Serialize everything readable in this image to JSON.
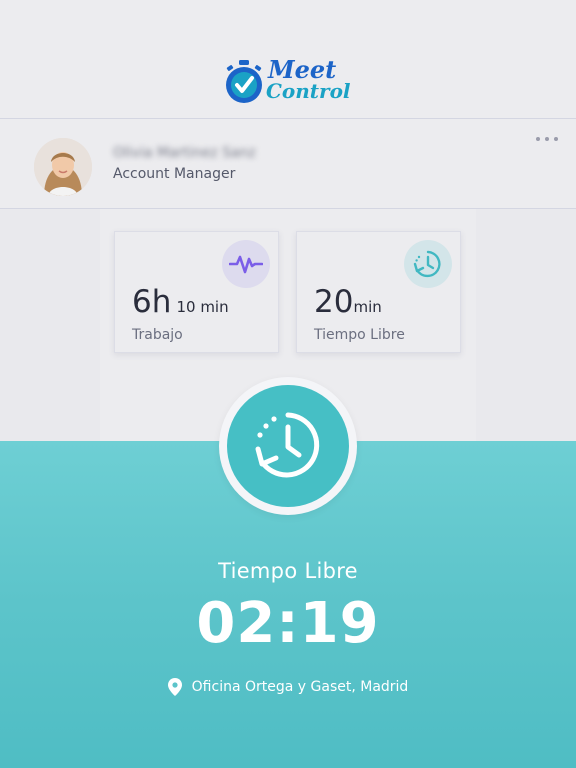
{
  "app": {
    "logo_word1": "Meet",
    "logo_word2": "Control",
    "brand_colors": {
      "primary": "#1c64c8",
      "secondary": "#1aa2c5",
      "teal": "#4fbdc4"
    }
  },
  "profile": {
    "name": "Olivia Martinez Sanz",
    "role": "Account Manager",
    "avatar_icon": "user-photo",
    "more_icon": "more-horizontal-icon"
  },
  "stats": [
    {
      "id": "work",
      "value": "6h",
      "value_suffix": "10 min",
      "label": "Trabajo",
      "icon": "activity-pulse-icon",
      "icon_color": "#7b5ee8"
    },
    {
      "id": "free",
      "value": "20",
      "value_suffix": "min",
      "label": "Tiempo Libre",
      "icon": "clock-rewind-icon",
      "icon_color": "#41b8c2"
    }
  ],
  "status": {
    "label": "Tiempo Libre",
    "timer": "02:19",
    "icon": "clock-rewind-icon"
  },
  "location": {
    "text": "Oficina Ortega y Gaset, Madrid",
    "icon": "location-pin-icon"
  }
}
